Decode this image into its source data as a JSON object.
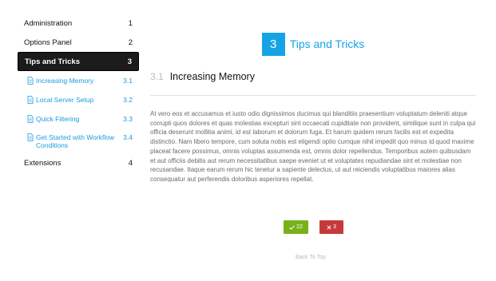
{
  "sidebar": {
    "items": [
      {
        "label": "Administration",
        "num": "1"
      },
      {
        "label": "Options Panel",
        "num": "2"
      },
      {
        "label": "Tips and Tricks",
        "num": "3"
      },
      {
        "label": "Extensions",
        "num": "4"
      }
    ],
    "subitems": [
      {
        "label": "Increasing Memory",
        "num": "3.1"
      },
      {
        "label": "Local Server Setup",
        "num": "3.2"
      },
      {
        "label": "Quick Filtering",
        "num": "3.3"
      },
      {
        "label": "Get Started with Workflow Conditions",
        "num": "3.4"
      }
    ]
  },
  "chapter": {
    "number": "3",
    "title": "Tips and Tricks"
  },
  "section": {
    "number": "3.1",
    "title": "Increasing Memory"
  },
  "body": "At vero eos et accusamus et iusto odio dignissimos ducimus qui blanditiis praesentium voluptatum deleniti atque corrupti quos dolores et quas molestias excepturi sint occaecati cupiditate non provident, similique sunt in culpa qui officia deserunt mollitia animi, id est laborum et dolorum fuga. Et harum quidem rerum facilis est et expedita distinctio. Nam libero tempore, cum soluta nobis est eligendi optio cumque nihil impedit quo minus id quod maxime placeat facere possimus, omnis voluptas assumenda est, omnis dolor repellendus. Temporibus autem quibusdam et aut officiis debitis aut rerum necessitatibus saepe eveniet ut et voluptates repudiandae sint et molestiae non recusandae. Itaque earum rerum hic tenetur a sapiente delectus, ut aut reiciendis voluptatibus maiores alias consequatur aut perferendis doloribus asperiores repellat.",
  "votes": {
    "up_count": "22",
    "down_count": "3"
  },
  "back_to_top": "Back To Top",
  "colors": {
    "accent": "#16a3e6",
    "active_nav": "#1b1b1b",
    "vote_up": "#79b11c",
    "vote_down": "#c6393b"
  },
  "icons": {
    "subitem": "document-icon",
    "up": "check-icon",
    "down": "x-icon"
  }
}
